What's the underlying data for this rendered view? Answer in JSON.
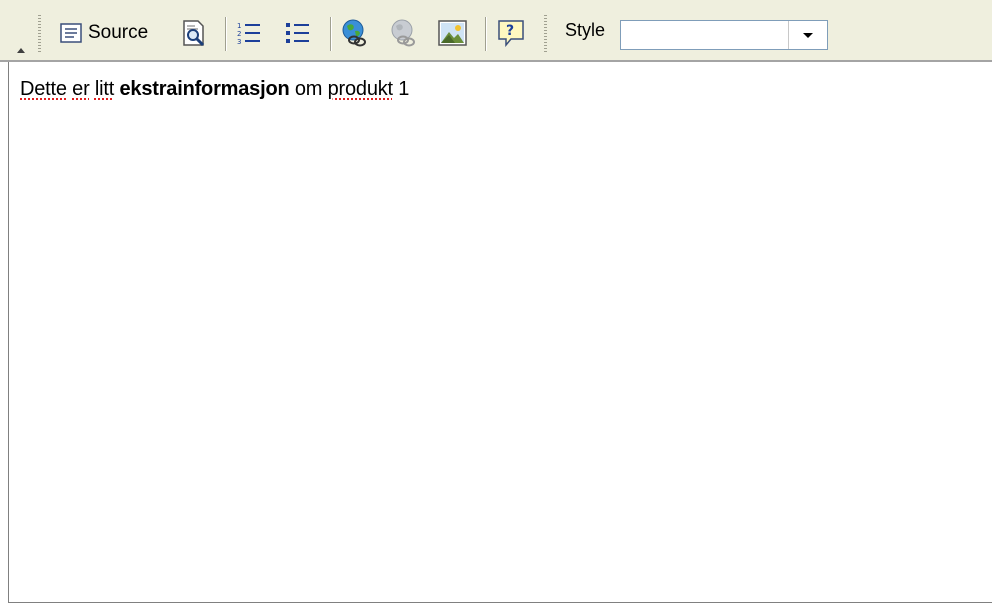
{
  "toolbar": {
    "source_label": "Source",
    "style_label": "Style",
    "style_select_value": "",
    "icons": [
      "collapse-arrow-icon",
      "source-icon",
      "preview-icon",
      "numbered-list-icon",
      "bulleted-list-icon",
      "insert-link-icon",
      "remove-link-icon",
      "insert-image-icon",
      "help-icon",
      "dropdown-arrow-icon"
    ]
  },
  "content": {
    "word_1": "Dette",
    "word_2": "er",
    "word_3": "litt",
    "bold_word": "ekstrainformasjon",
    "word_5": "om",
    "word_6": "produkt",
    "word_7": "1"
  },
  "colors": {
    "toolbar_background": "#efefde",
    "spellcheck_underline": "#e02020",
    "select_border": "#7f9db9"
  }
}
